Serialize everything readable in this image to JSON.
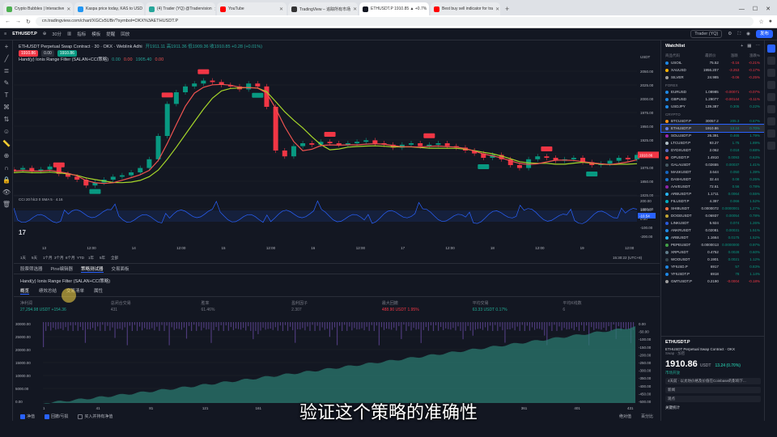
{
  "browser": {
    "tabs": [
      {
        "title": "Crypto Bubbles | Interactive",
        "color": "#4caf50",
        "active": false
      },
      {
        "title": "Kaspa price today, KAS to USD",
        "color": "#2196f3",
        "active": false
      },
      {
        "title": "(4) Trader (YQ) @Tradervision",
        "color": "#26a69a",
        "active": false
      },
      {
        "title": "YouTube",
        "color": "#ff0000",
        "active": false
      },
      {
        "title": "TradingView – 追踪所有市场",
        "color": "#333333",
        "active": false
      },
      {
        "title": "ETHUSDT.P 1910.85 ▲ +0.7%",
        "color": "#131722",
        "active": true
      },
      {
        "title": "Best buy sell indicator for tra",
        "color": "#ff0000",
        "active": false
      }
    ],
    "url": "cn.tradingview.com/chart/XGCx5UBr/?symbol=OKX%3AETHUSDT.P"
  },
  "toolbar": {
    "symbol": "ETHUSDT.P",
    "interval": "30分",
    "items": [
      "指标",
      "模板",
      "提醒",
      "回放"
    ],
    "trader": "Trader (YQ)",
    "publish": "发布"
  },
  "legend": {
    "title": "ETHUSDT Perpetual Swap Contract · 30 · OKX · Weblink Adhi",
    "ohlc": "开1911.11 高1911.36 低1909.36 收1910.85 +0.28 (+0.01%)",
    "price_sell": "1910.86",
    "price_mid": "0.00",
    "price_buy": "1910.86",
    "indicator": "Hand(y) Ionis Range Filter (SALAN+CCI策略)",
    "indicator_vals": [
      "0.00",
      "0.00",
      "1905.40",
      "0.00"
    ]
  },
  "chart_axes": {
    "price_ticks": [
      "USDT",
      "2050.00",
      "2025.00",
      "2000.00",
      "1975.00",
      "1950.00",
      "1925.00",
      "1900.00",
      "1875.00",
      "1850.00",
      "1825.00",
      "1800.00"
    ],
    "current_price": "1910.86",
    "osc_ticks": [
      "200.00",
      "100.00",
      "0.00",
      "-100.00",
      "-200.00"
    ],
    "osc_value": "-10.54",
    "osc_label": "CCI 20 hlc3 0 SMA 5 · 4.16",
    "time_ticks": [
      "13",
      "12:00",
      "14",
      "12:00",
      "15",
      "12:00",
      "16",
      "12:00",
      "17",
      "12:00",
      "18",
      "12:00",
      "19",
      "12:00"
    ],
    "timestamp": "15:30:22 (UTC+8)",
    "range_buttons": [
      "1天",
      "5天",
      "1个月",
      "3个月",
      "6个月",
      "YTD",
      "1年",
      "5年",
      "全部"
    ]
  },
  "bottom_panel": {
    "tabs": [
      "股票筛选器",
      "Pine编辑器",
      "策略测试器",
      "交易面板"
    ],
    "active_tab": "策略测试器",
    "strategy": "Hand(y) Ionis Range Filter (SALAN+CCI策略)",
    "sub_tabs": [
      "概览",
      "绩效总结",
      "交易清单",
      "属性"
    ],
    "stats": [
      {
        "label": "净利润",
        "value": "27,294.98 USDT",
        "sub": "+154.36",
        "tone": "green"
      },
      {
        "label": "总闭合交易",
        "value": "431",
        "sub": "",
        "tone": "neutral"
      },
      {
        "label": "胜率",
        "value": "61.46%",
        "sub": "",
        "tone": "neutral"
      },
      {
        "label": "盈利因子",
        "value": "2.307",
        "sub": "",
        "tone": "neutral"
      },
      {
        "label": "最大回撤",
        "value": "488.90 USDT",
        "sub": "1.95%",
        "tone": "red"
      },
      {
        "label": "平均交易",
        "value": "63.33 USDT",
        "sub": "0.17%",
        "tone": "green"
      },
      {
        "label": "平均K线数",
        "value": "6",
        "sub": "",
        "tone": "neutral"
      }
    ],
    "eq_ticks_left": [
      "30000.00",
      "25000.00",
      "20000.00",
      "15000.00",
      "10000.00",
      "5000.00",
      "0.00"
    ],
    "eq_ticks_right": [
      "0.00",
      "-50.00",
      "-100.00",
      "-150.00",
      "-200.00",
      "-250.00",
      "-300.00",
      "-350.00",
      "-400.00",
      "-450.00",
      "-500.00"
    ],
    "eq_x_ticks": [
      "1",
      "41",
      "81",
      "121",
      "161",
      "201",
      "241",
      "281",
      "321",
      "361",
      "401",
      "431"
    ],
    "footer": [
      "净值",
      "回撤/亏损",
      "买入并持有净值",
      "绝对值",
      "百分比"
    ]
  },
  "watchlist": {
    "title": "Watchlist",
    "cols": [
      "商品代码",
      "最新价",
      "涨跌",
      "涨跌%"
    ],
    "sections": [
      {
        "name": "",
        "rows": [
          {
            "sym": "USOIL",
            "price": "75.52",
            "chg": "-0.16",
            "pct": "-0.21%",
            "up": false,
            "dot": "#1e88e5"
          },
          {
            "sym": "XAUUSD",
            "price": "1956.207",
            "chg": "-3.253",
            "pct": "-0.17%",
            "up": false,
            "dot": "#ffb300"
          },
          {
            "sym": "SILVER",
            "price": "24.985",
            "chg": "-0.06",
            "pct": "-0.25%",
            "up": false,
            "dot": "#9e9e9e"
          }
        ]
      },
      {
        "name": "FOREX",
        "rows": [
          {
            "sym": "EURUSD",
            "price": "1.08985",
            "chg": "-0.00071",
            "pct": "-0.07%",
            "up": false,
            "dot": "#1e88e5"
          },
          {
            "sym": "GBPUSD",
            "price": "1.29077",
            "chg": "-0.00144",
            "pct": "-0.11%",
            "up": false,
            "dot": "#1e88e5"
          },
          {
            "sym": "USDJPY",
            "price": "139.387",
            "chg": "0.305",
            "pct": "0.22%",
            "up": true,
            "dot": "#1e88e5"
          }
        ]
      },
      {
        "name": "CRYPTO",
        "rows": [
          {
            "sym": "BTCUSDT.P",
            "price": "30057.2",
            "chg": "205.3",
            "pct": "0.67%",
            "up": true,
            "dot": "#f7931a"
          },
          {
            "sym": "ETHUSDT.P",
            "price": "1910.86",
            "chg": "13.24",
            "pct": "0.70%",
            "up": true,
            "dot": "#627eea",
            "selected": true
          },
          {
            "sym": "SOLUSDT.P",
            "price": "26.391",
            "chg": "0.465",
            "pct": "1.79%",
            "up": true,
            "dot": "#9c27b0"
          },
          {
            "sym": "LTCUSDT.P",
            "price": "93.27",
            "chg": "1.75",
            "pct": "1.89%",
            "up": true,
            "dot": "#b0bec5"
          },
          {
            "sym": "DYDXUSDT",
            "price": "2.062",
            "chg": "0.018",
            "pct": "0.88%",
            "up": true,
            "dot": "#5c6bc0"
          },
          {
            "sym": "OPUSDT.P",
            "price": "1.4910",
            "chg": "0.0093",
            "pct": "0.63%",
            "up": true,
            "dot": "#f44336"
          },
          {
            "sym": "GALAUSDT",
            "price": "0.02655",
            "chg": "0.00037",
            "pct": "1.41%",
            "up": true,
            "dot": "#455a64"
          },
          {
            "sym": "MASKUSDT",
            "price": "3.644",
            "chg": "0.050",
            "pct": "1.39%",
            "up": true,
            "dot": "#1565c0"
          },
          {
            "sym": "DASHUSDT",
            "price": "32.44",
            "chg": "0.08",
            "pct": "0.25%",
            "up": true,
            "dot": "#1976d2"
          },
          {
            "sym": "AAVEUSDT",
            "price": "72.61",
            "chg": "0.56",
            "pct": "0.78%",
            "up": true,
            "dot": "#8e24aa"
          },
          {
            "sym": "ARBUSDT.P",
            "price": "1.1711",
            "chg": "0.0064",
            "pct": "0.55%",
            "up": true,
            "dot": "#29b6f6"
          },
          {
            "sym": "FILUSDT.P",
            "price": "4.397",
            "chg": "0.066",
            "pct": "1.52%",
            "up": true,
            "dot": "#00acc1"
          },
          {
            "sym": "SHIBUSDT",
            "price": "0.0000072",
            "chg": "0.0000001",
            "pct": "1.27%",
            "up": true,
            "dot": "#ff7043"
          },
          {
            "sym": "DOGEUSDT",
            "price": "0.06937",
            "chg": "0.00054",
            "pct": "0.78%",
            "up": true,
            "dot": "#c2a633"
          },
          {
            "sym": "LINKUSDT",
            "price": "5.924",
            "chg": "0.074",
            "pct": "1.26%",
            "up": true,
            "dot": "#2a5ada"
          },
          {
            "sym": "ANKRUSDT",
            "price": "0.02081",
            "chg": "0.00031",
            "pct": "1.51%",
            "up": true,
            "dot": "#1e88e5"
          },
          {
            "sym": "ARBUSDT",
            "price": "1.1664",
            "chg": "0.0175",
            "pct": "1.52%",
            "up": true,
            "dot": "#29b6f6"
          },
          {
            "sym": "PEPEUSDT",
            "price": "0.0000013",
            "chg": "0.0000000",
            "pct": "0.97%",
            "up": true,
            "dot": "#43a047"
          },
          {
            "sym": "XRPUSDT",
            "price": "0.4752",
            "chg": "0.0028",
            "pct": "0.60%",
            "up": true,
            "dot": "#607d8b"
          },
          {
            "sym": "WOOUSDT",
            "price": "0.1901",
            "chg": "0.0021",
            "pct": "1.12%",
            "up": true,
            "dot": "#37474f"
          },
          {
            "sym": "YFIUSD.P",
            "price": "6917",
            "chg": "57",
            "pct": "0.83%",
            "up": true,
            "dot": "#1e88e5"
          },
          {
            "sym": "YFIUSDT.P",
            "price": "6918",
            "chg": "78",
            "pct": "1.14%",
            "up": true,
            "dot": "#1e88e5"
          },
          {
            "sym": "GMTUSDT.P",
            "price": "0.2190",
            "chg": "-0.0004",
            "pct": "-0.18%",
            "up": false,
            "dot": "#9e9e9e"
          }
        ]
      }
    ],
    "detail": {
      "symbol": "ETHUSDT.P",
      "name": "ETHUSDT Perpetual Swap Contract",
      "exchange": "OKX",
      "type": "Swap · 加密",
      "price": "1910.86",
      "unit": "USDT",
      "chg": "13.24 (0.70%)",
      "status": "市场开放",
      "note": "4天前 · 以太坊价格及价值在Coinbase的影响下...",
      "buttons": [
        "新闻",
        "观点"
      ],
      "footer": "关键统计"
    }
  },
  "subtitle": "验证这个策略的准确性",
  "colors": {
    "up": "#089981",
    "down": "#f23645",
    "ma_red": "#ef5350",
    "ma_green": "#a6d62a",
    "cci": "#2962ff",
    "accent": "#2962ff",
    "equity": "#2b7a6f"
  }
}
